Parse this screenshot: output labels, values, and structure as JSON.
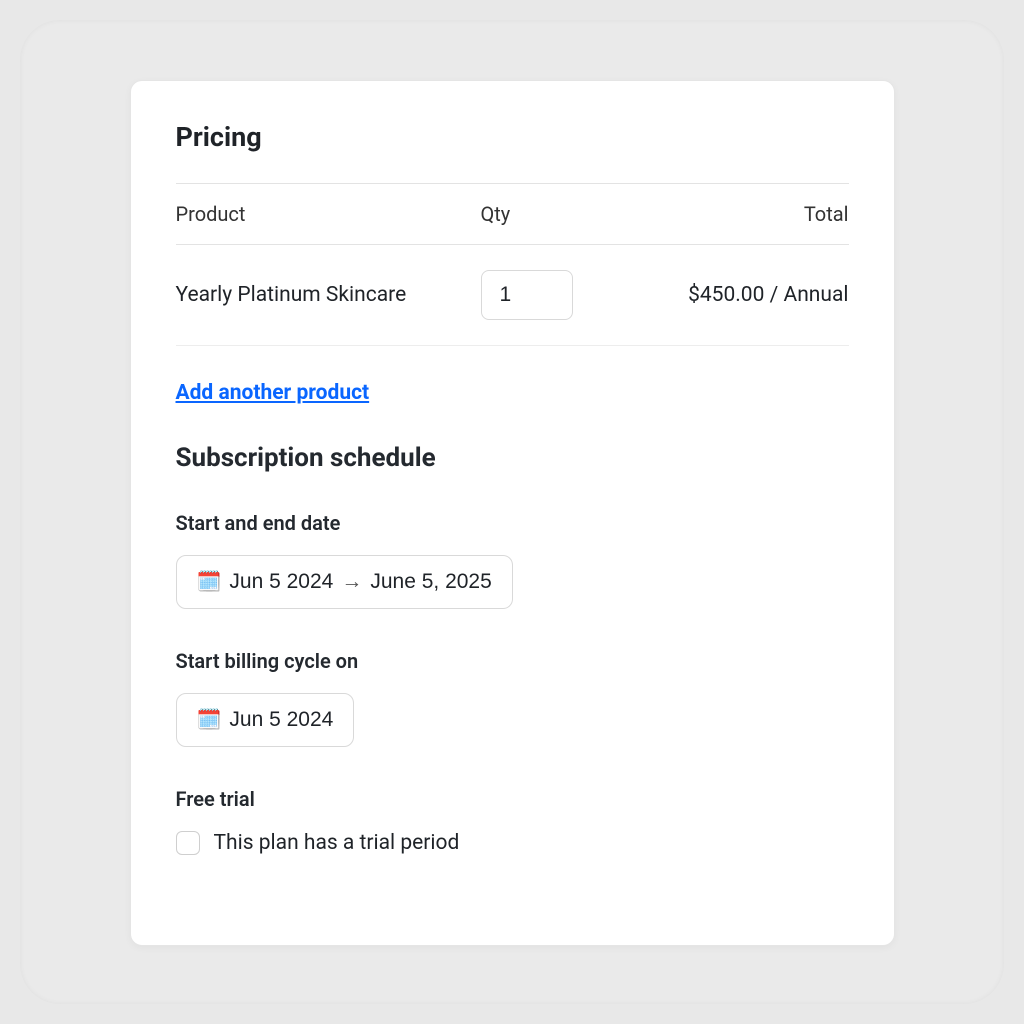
{
  "pricing": {
    "title": "Pricing",
    "columns": {
      "product": "Product",
      "qty": "Qty",
      "total": "Total"
    },
    "row": {
      "product": "Yearly Platinum Skincare",
      "qty": "1",
      "total": "$450.00 / Annual"
    },
    "add_link": "Add another product"
  },
  "schedule": {
    "title": "Subscription schedule",
    "start_end": {
      "label": "Start and end date",
      "start": "Jun 5 2024",
      "arrow": "→",
      "end": "June 5, 2025"
    },
    "billing": {
      "label": "Start billing cycle on",
      "date": "Jun 5 2024"
    },
    "trial": {
      "label": "Free trial",
      "checkbox_label": "This plan has a trial period"
    }
  },
  "icons": {
    "calendar": "🗓️"
  }
}
